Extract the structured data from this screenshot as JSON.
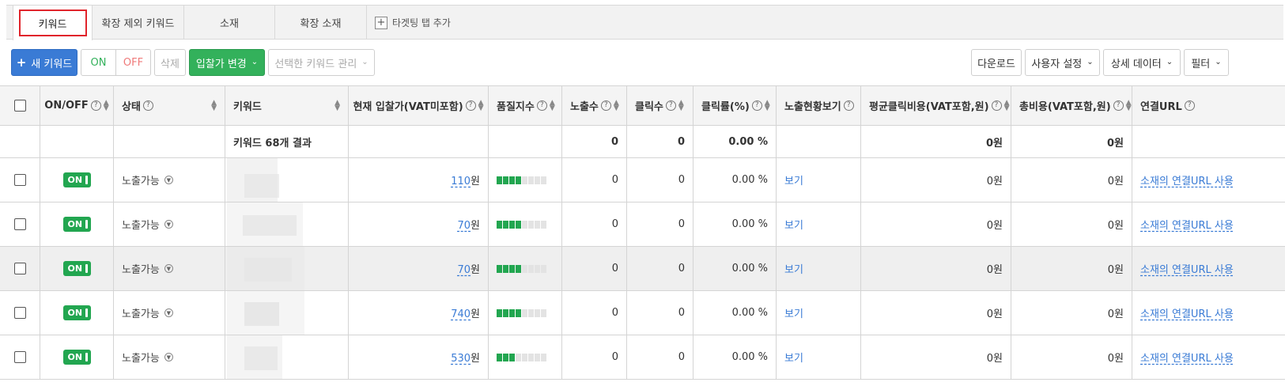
{
  "tabs": [
    {
      "label": "키워드"
    },
    {
      "label": "확장 제외 키워드"
    },
    {
      "label": "소재"
    },
    {
      "label": "확장 소재"
    }
  ],
  "tab_add_label": "타겟팅 탭 추가",
  "toolbar": {
    "new_keyword": "새 키워드",
    "on": "ON",
    "off": "OFF",
    "delete": "삭제",
    "bid_change": "입찰가 변경",
    "manage_selected": "선택한 키워드 관리",
    "download": "다운로드",
    "user_settings": "사용자 설정",
    "detail_data": "상세 데이터",
    "filter": "필터"
  },
  "columns": {
    "onoff": "ON/OFF",
    "status": "상태",
    "keyword": "키워드",
    "bid": "현재 입찰가(VAT미포함)",
    "quality": "품질지수",
    "impressions": "노출수",
    "clicks": "클릭수",
    "ctr": "클릭률(%)",
    "exposure_view": "노출현황보기",
    "avg_cpc": "평균클릭비용(VAT포함,원)",
    "total_cost": "총비용(VAT포함,원)",
    "url": "연결URL"
  },
  "summary": {
    "label": "키워드 68개 결과",
    "impressions": "0",
    "clicks": "0",
    "ctr": "0.00 %",
    "avg_cpc": "0원",
    "total_cost": "0원"
  },
  "rows": [
    {
      "toggle": "ON",
      "status": "노출가능",
      "bid": "110",
      "bid_unit": "원",
      "quality_level": 4,
      "impressions": "0",
      "clicks": "0",
      "ctr": "0.00 %",
      "view": "보기",
      "avg_cpc": "0원",
      "total_cost": "0원",
      "url": "소재의 연결URL 사용"
    },
    {
      "toggle": "ON",
      "status": "노출가능",
      "bid": "70",
      "bid_unit": "원",
      "quality_level": 4,
      "impressions": "0",
      "clicks": "0",
      "ctr": "0.00 %",
      "view": "보기",
      "avg_cpc": "0원",
      "total_cost": "0원",
      "url": "소재의 연결URL 사용"
    },
    {
      "toggle": "ON",
      "status": "노출가능",
      "bid": "70",
      "bid_unit": "원",
      "quality_level": 4,
      "impressions": "0",
      "clicks": "0",
      "ctr": "0.00 %",
      "view": "보기",
      "avg_cpc": "0원",
      "total_cost": "0원",
      "url": "소재의 연결URL 사용"
    },
    {
      "toggle": "ON",
      "status": "노출가능",
      "bid": "740",
      "bid_unit": "원",
      "quality_level": 4,
      "impressions": "0",
      "clicks": "0",
      "ctr": "0.00 %",
      "view": "보기",
      "avg_cpc": "0원",
      "total_cost": "0원",
      "url": "소재의 연결URL 사용"
    },
    {
      "toggle": "ON",
      "status": "노출가능",
      "bid": "530",
      "bid_unit": "원",
      "quality_level": 3,
      "impressions": "0",
      "clicks": "0",
      "ctr": "0.00 %",
      "view": "보기",
      "avg_cpc": "0원",
      "total_cost": "0원",
      "url": "소재의 연결URL 사용"
    }
  ],
  "colors": {
    "accent_blue": "#3a7bd5",
    "green": "#22a650",
    "active_tab_border": "#e0242b"
  }
}
